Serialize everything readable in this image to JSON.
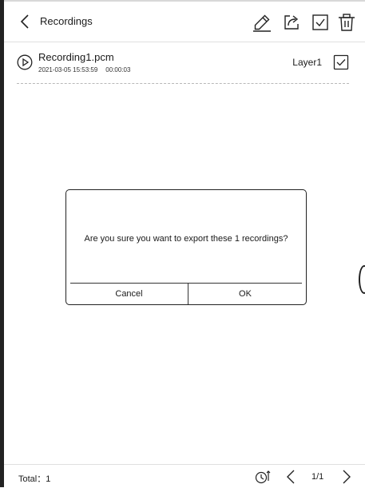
{
  "header": {
    "back_icon": "chevron-left-icon",
    "title": "Recordings",
    "actions": [
      {
        "name": "edit-button",
        "icon": "pencil-icon"
      },
      {
        "name": "export-button",
        "icon": "share-icon"
      },
      {
        "name": "select-all-button",
        "icon": "checkbox-checked-icon"
      },
      {
        "name": "delete-button",
        "icon": "trash-icon"
      }
    ]
  },
  "recordings": [
    {
      "name": "Recording1.pcm",
      "date": "2021-03-05 15:53:59",
      "duration": "00:00:03",
      "layer": "Layer1",
      "selected": true
    }
  ],
  "dialog": {
    "message": "Are you sure you want to export these 1 recordings?",
    "cancel_label": "Cancel",
    "ok_label": "OK"
  },
  "footer": {
    "total": "Total：1",
    "sort_icon": "clock-sort-icon",
    "prev_icon": "chevron-left-icon",
    "page": "1/1",
    "next_icon": "chevron-right-icon"
  },
  "colors": {
    "ink": "#1a1a1a",
    "background": "#ffffff",
    "divider": "#e0e0e0"
  }
}
